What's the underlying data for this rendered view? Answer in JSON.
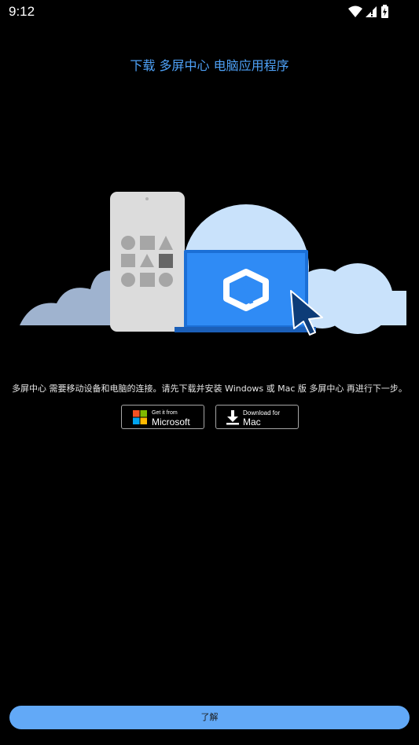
{
  "status_bar": {
    "time": "9:12",
    "icons": [
      "wifi-icon",
      "cellular-signal-icon",
      "battery-charging-icon"
    ]
  },
  "title": "下载 多屏中心 电脑应用程序",
  "description": "多屏中心 需要移动设备和电脑的连接。请先下载并安装 Windows 或 Mac 版 多屏中心 再进行下一步。",
  "microsoft_button": {
    "small_text": "Get it from",
    "big_text": "Microsoft"
  },
  "mac_button": {
    "small_text": "Download for",
    "big_text": "Mac"
  },
  "ok_button": {
    "label": "了解"
  },
  "colors": {
    "background": "#000000",
    "title": "#4ea1f7",
    "primary_button": "#62a9f7",
    "laptop": "#1e7ff0",
    "cloud_light": "#c9e2fb",
    "cloud_shadow": "#9fb3cf",
    "phone": "#dcdcdc"
  }
}
